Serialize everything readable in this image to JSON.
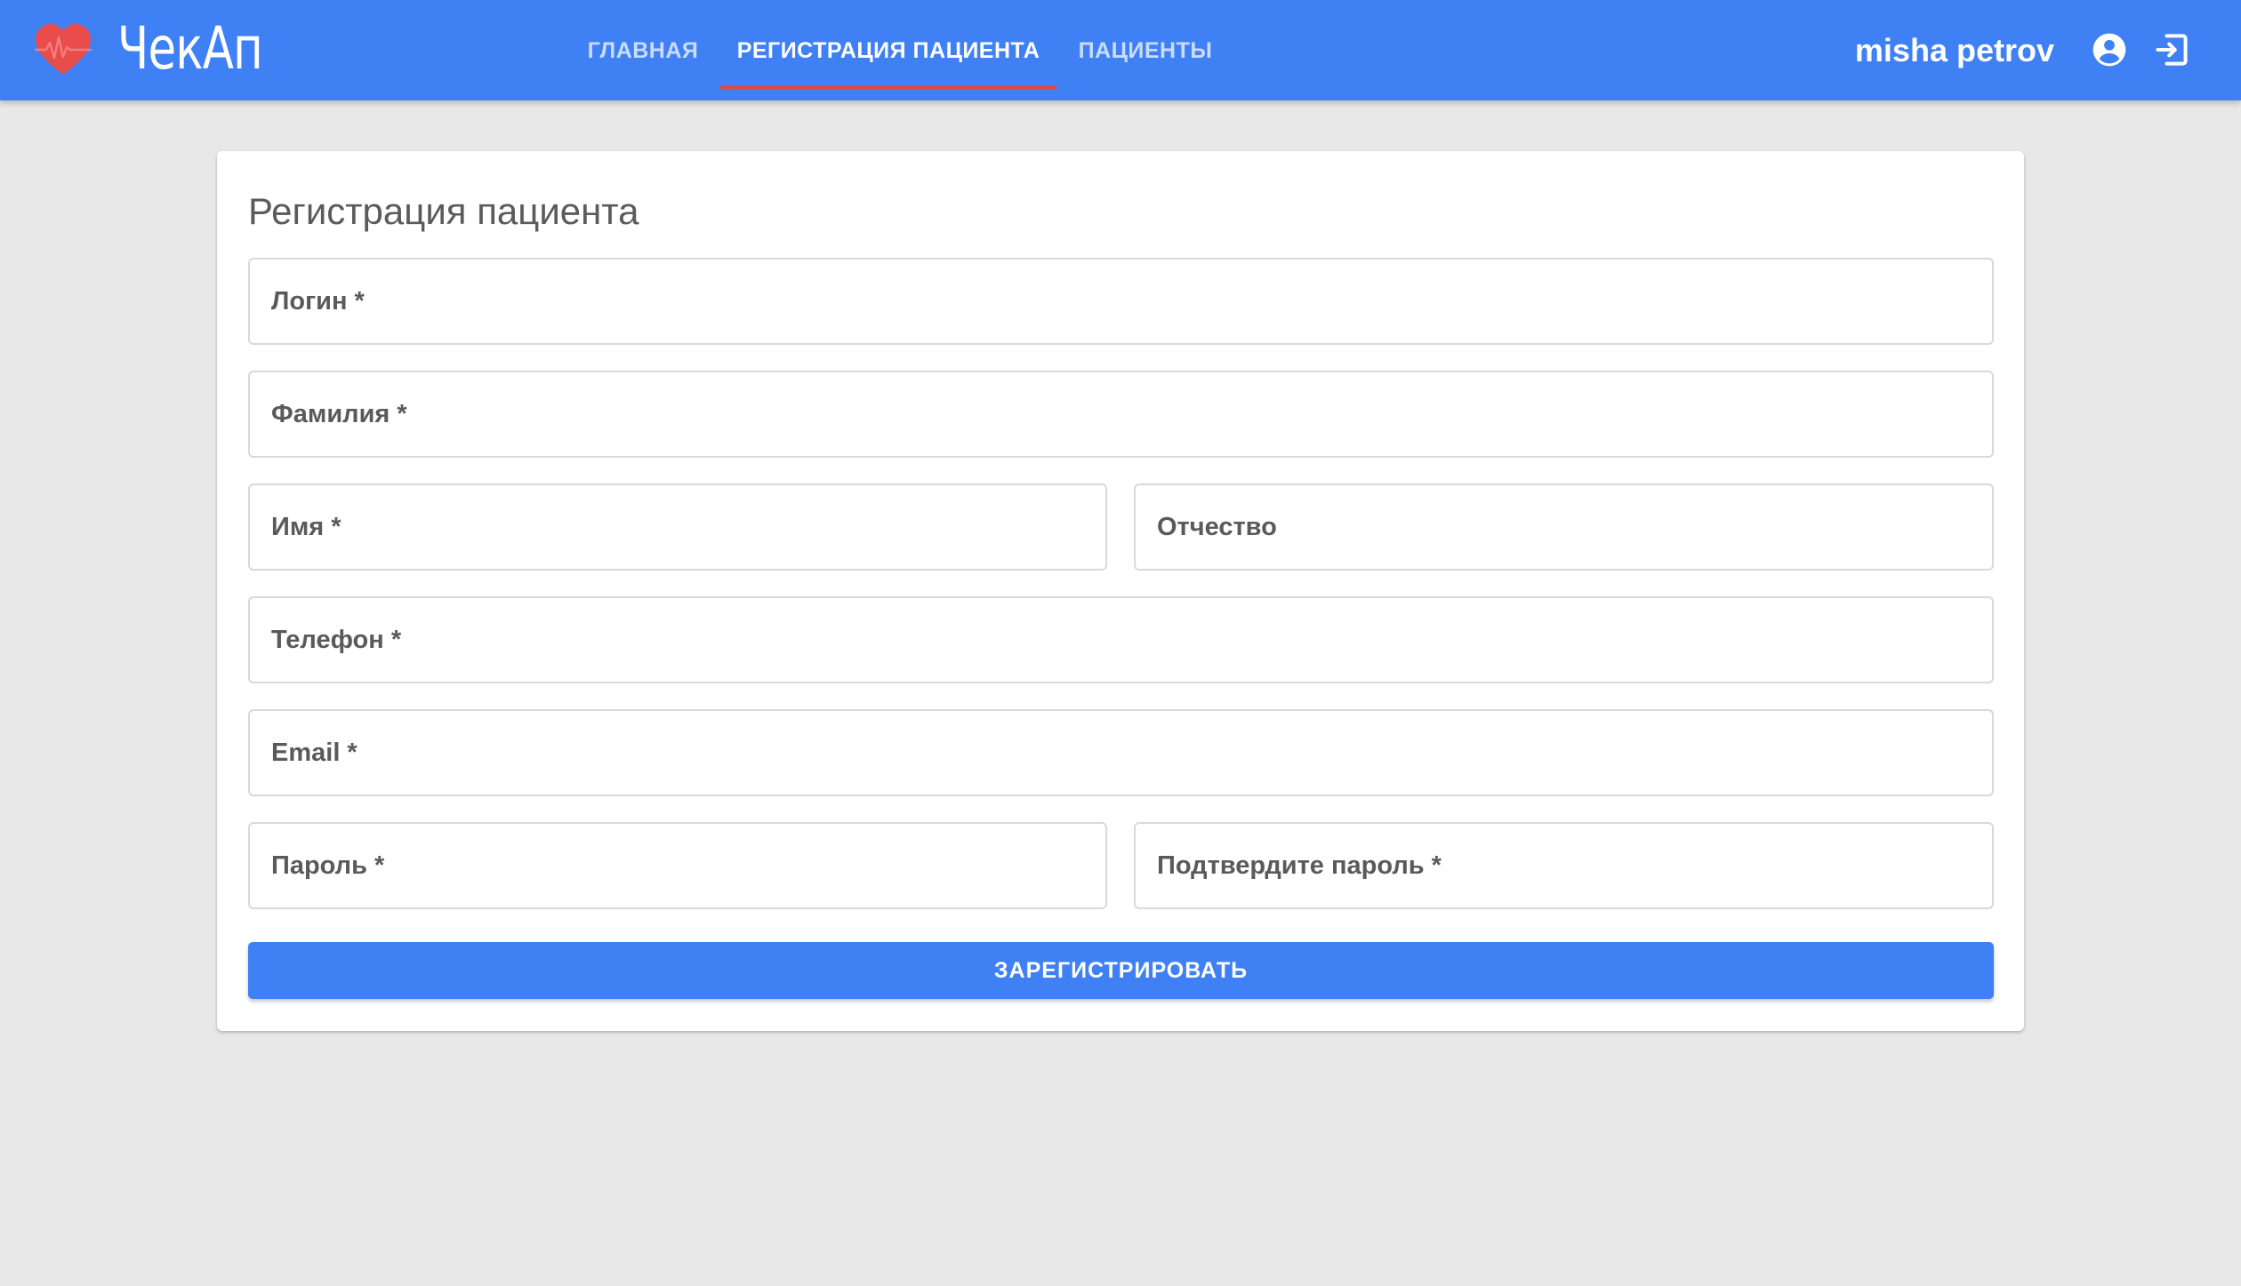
{
  "app": {
    "logo_text": "ЧекАп",
    "logo_icon": "heart-pulse-icon"
  },
  "nav": {
    "tabs": [
      {
        "label": "ГЛАВНАЯ",
        "active": false
      },
      {
        "label": "РЕГИСТРАЦИЯ ПАЦИЕНТА",
        "active": true
      },
      {
        "label": "ПАЦИЕНТЫ",
        "active": false
      }
    ]
  },
  "header": {
    "username": "misha petrov",
    "account_icon": "account-circle-icon",
    "logout_icon": "logout-icon"
  },
  "form": {
    "title": "Регистрация пациента",
    "fields": {
      "login": {
        "placeholder": "Логин *",
        "value": ""
      },
      "last_name": {
        "placeholder": "Фамилия *",
        "value": ""
      },
      "first_name": {
        "placeholder": "Имя *",
        "value": ""
      },
      "patronymic": {
        "placeholder": "Отчество",
        "value": ""
      },
      "phone": {
        "placeholder": "Телефон *",
        "value": ""
      },
      "email": {
        "placeholder": "Email *",
        "value": ""
      },
      "password": {
        "placeholder": "Пароль *",
        "value": ""
      },
      "password_confirm": {
        "placeholder": "Подтвердите пароль *",
        "value": ""
      }
    },
    "submit_label": "ЗАРЕГИСТРИРОВАТЬ"
  },
  "colors": {
    "primary": "#3f80f5",
    "tab_indicator": "#e8453c",
    "logo_heart": "#e84d4b",
    "background": "#e8e8e8"
  }
}
